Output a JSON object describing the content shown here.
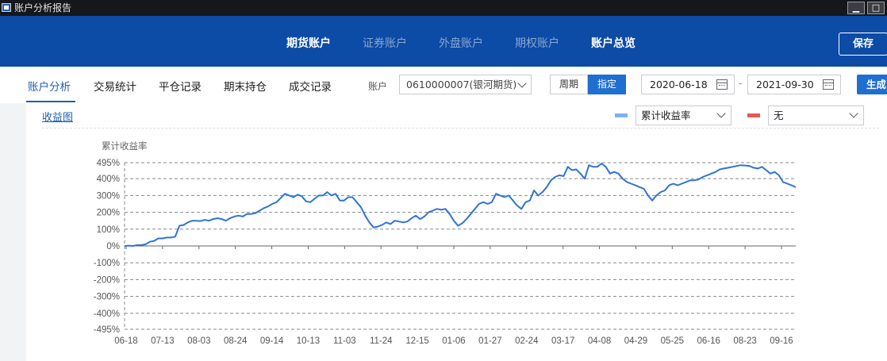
{
  "window": {
    "title": "账户分析报告",
    "minimize_glyph": "▁",
    "maximize_glyph": "□"
  },
  "top_nav": {
    "tabs": [
      {
        "label": "期货账户",
        "state": "active"
      },
      {
        "label": "证券账户",
        "state": "inactive"
      },
      {
        "label": "外盘账户",
        "state": "inactive"
      },
      {
        "label": "期权账户",
        "state": "inactive"
      },
      {
        "label": "账户总览",
        "state": "bold"
      }
    ],
    "save_label": "保存"
  },
  "sub_nav": {
    "tabs": [
      "账户分析",
      "交易统计",
      "平仓记录",
      "期末持仓",
      "成交记录"
    ],
    "active_tab": "账户分析"
  },
  "account": {
    "label": "账户",
    "value": "0610000007(银河期货)"
  },
  "period": {
    "period_label": "周期",
    "custom_label": "指定",
    "selected": "指定"
  },
  "date_range": {
    "start": "2020-06-18",
    "separator": "-",
    "end": "2021-09-30"
  },
  "generate_label": "生成",
  "chart_tab_label": "收益图",
  "series_select_1": {
    "value": "累计收益率",
    "color": "#7eb3ef"
  },
  "series_select_2": {
    "value": "无",
    "color": "#e05a5a"
  },
  "colors": {
    "brand_blue": "#0c4ba6",
    "accent_blue": "#1f6fd1",
    "line": "#2f74d6"
  },
  "chart_data": {
    "type": "line",
    "ylabel": "累计收益率",
    "ylim": [
      -495,
      495
    ],
    "y_ticks": [
      495,
      400,
      300,
      200,
      100,
      0,
      -100,
      -200,
      -300,
      -400,
      -495
    ],
    "y_tick_labels": [
      "495%",
      "400%",
      "300%",
      "200%",
      "100%",
      "0%",
      "-100%",
      "-200%",
      "-300%",
      "-400%",
      "-495%"
    ],
    "x_tick_labels": [
      "06-18",
      "07-13",
      "08-03",
      "08-24",
      "09-14",
      "10-13",
      "11-03",
      "11-24",
      "12-15",
      "01-06",
      "01-27",
      "02-24",
      "03-17",
      "04-08",
      "04-29",
      "05-25",
      "06-16",
      "08-23",
      "09-16"
    ],
    "grid": "horizontal-dashed",
    "series": [
      {
        "values": [
          0,
          2,
          0,
          5,
          5,
          10,
          25,
          30,
          45,
          45,
          50,
          50,
          55,
          120,
          125,
          140,
          150,
          150,
          148,
          155,
          150,
          160,
          165,
          160,
          150,
          165,
          175,
          180,
          175,
          190,
          190,
          195,
          210,
          225,
          235,
          250,
          260,
          285,
          310,
          300,
          290,
          305,
          295,
          265,
          260,
          280,
          300,
          300,
          320,
          300,
          310,
          270,
          270,
          290,
          290,
          260,
          230,
          180,
          140,
          110,
          115,
          125,
          140,
          130,
          150,
          145,
          140,
          145,
          165,
          180,
          160,
          175,
          200,
          210,
          220,
          215,
          220,
          190,
          150,
          120,
          135,
          160,
          190,
          220,
          250,
          260,
          250,
          260,
          310,
          300,
          290,
          300,
          270,
          240,
          220,
          260,
          270,
          330,
          300,
          320,
          350,
          390,
          410,
          420,
          415,
          470,
          450,
          455,
          430,
          400,
          480,
          470,
          470,
          490,
          470,
          430,
          440,
          430,
          400,
          380,
          370,
          360,
          350,
          340,
          300,
          270,
          300,
          320,
          330,
          360,
          370,
          360,
          370,
          380,
          390,
          390,
          395,
          410,
          420,
          430,
          440,
          455,
          460,
          465,
          470,
          475,
          480,
          478,
          475,
          465,
          460,
          470,
          450,
          430,
          440,
          420,
          380,
          370,
          360,
          350
        ]
      }
    ]
  }
}
